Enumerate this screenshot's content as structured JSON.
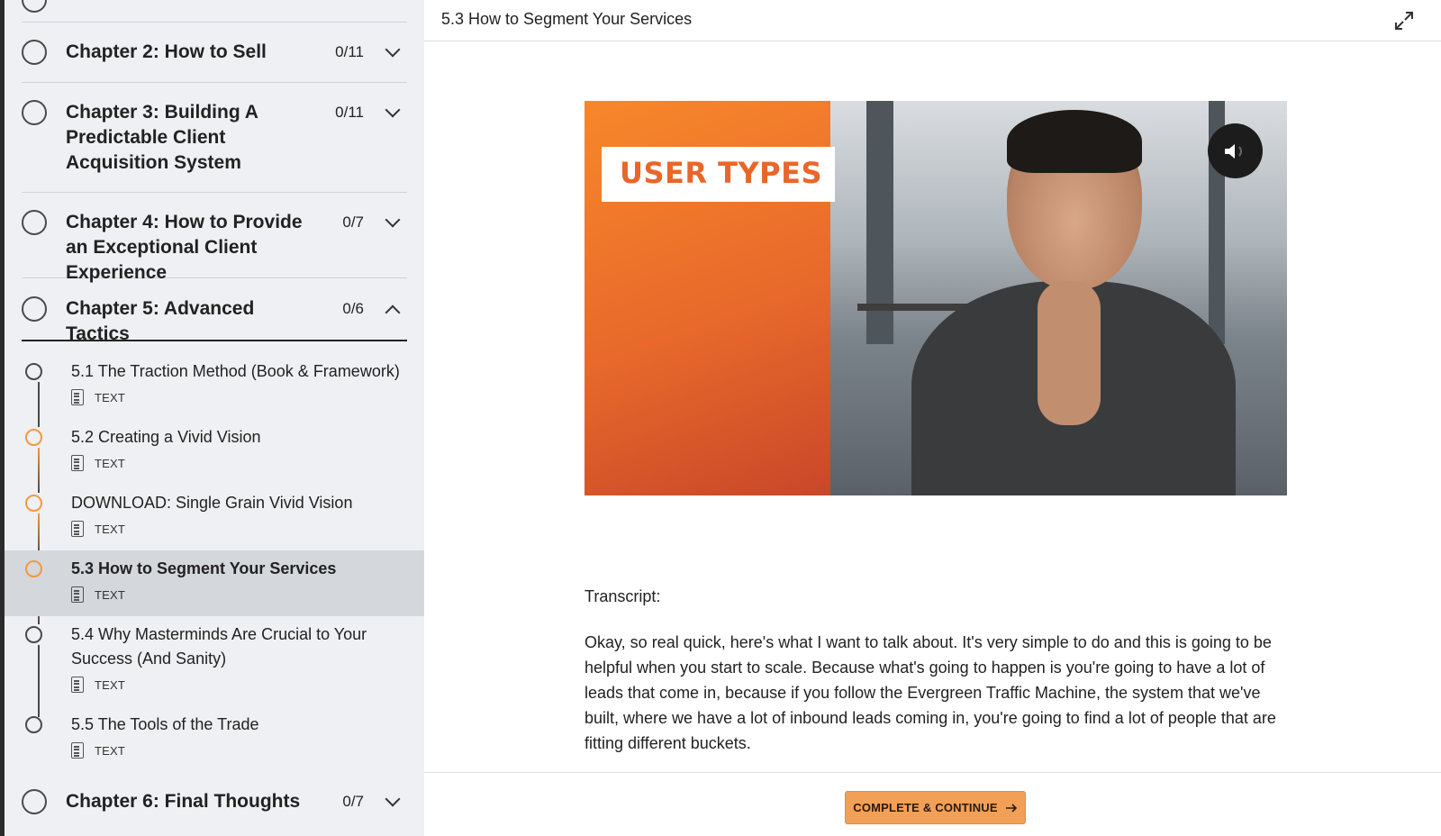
{
  "sidebar": {
    "chapters": [
      {
        "title": "Chapter 2: How to Sell",
        "count": "0/11"
      },
      {
        "title": "Chapter 3: Building A Predictable Client Acquisition System",
        "count": "0/11"
      },
      {
        "title": "Chapter 4: How to Provide an Exceptional Client Experience",
        "count": "0/7"
      },
      {
        "title": "Chapter 5: Advanced Tactics",
        "count": "0/6"
      },
      {
        "title": "Chapter 6: Final Thoughts",
        "count": "0/7"
      }
    ],
    "lessons": [
      {
        "title": "5.1 The Traction Method (Book & Framework)",
        "type": "TEXT"
      },
      {
        "title": "5.2 Creating a Vivid Vision",
        "type": "TEXT"
      },
      {
        "title": "DOWNLOAD: Single Grain Vivid Vision",
        "type": "TEXT"
      },
      {
        "title": "5.3 How to Segment Your Services",
        "type": "TEXT"
      },
      {
        "title": "5.4 Why Masterminds Are Crucial to Your Success (And Sanity)",
        "type": "TEXT"
      },
      {
        "title": "5.5 The Tools of the Trade",
        "type": "TEXT"
      }
    ]
  },
  "main": {
    "title": "5.3 How to Segment Your Services",
    "video": {
      "label": "USER TYPES"
    },
    "transcript_label": "Transcript:",
    "transcript": "Okay, so real quick, here's what I want to talk about. It's very simple to do and this is going to be helpful when you start to scale. Because what's going to happen is you're going to have a lot of leads that come in, because if you follow the Evergreen Traffic Machine, the system that we've built, where we have a lot of inbound leads coming in, you're going to find a lot of people that are fitting different buckets.",
    "continue_label": "COMPLETE & CONTINUE"
  },
  "colors": {
    "accent": "#f2a057",
    "in_progress": "#f2993e",
    "sidebar_bg": "#eef0f3",
    "active_row": "#d4d7dc"
  },
  "icons": [
    "expand-icon",
    "volume-icon",
    "arrow-right-icon",
    "text-document-icon",
    "chevron-down-icon",
    "chevron-up-icon"
  ]
}
